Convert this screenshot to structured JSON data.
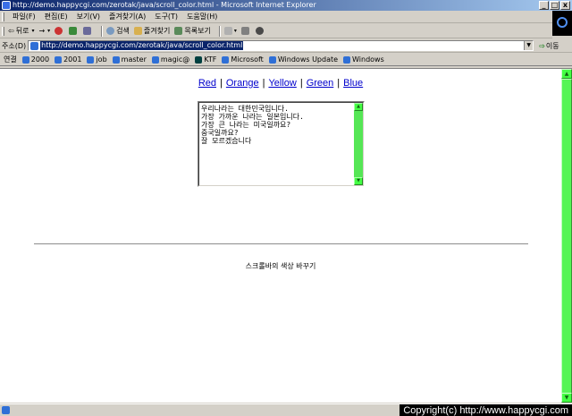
{
  "window": {
    "title": "http://demo.happycgi.com/zerotak/java/scroll_color.html - Microsoft Internet Explorer",
    "min_glyph": "_",
    "max_glyph": "□",
    "close_glyph": "x"
  },
  "menubar": {
    "items": [
      "파일(F)",
      "편집(E)",
      "보기(V)",
      "즐겨찾기(A)",
      "도구(T)",
      "도움말(H)"
    ]
  },
  "toolbar": {
    "back": "뒤로",
    "forward": "→",
    "search": "검색",
    "favorites": "즐겨찾기",
    "history": "목록보기"
  },
  "address": {
    "label": "주소(D)",
    "url": "http://demo.happycgi.com/zerotak/java/scroll_color.html",
    "go": "이동"
  },
  "links": {
    "label": "연결",
    "items": [
      "2000",
      "2001",
      "job",
      "master",
      "magic@",
      "KTF",
      "Microsoft",
      "Windows Update",
      "Windows"
    ]
  },
  "page": {
    "color_links": [
      "Red",
      "Orange",
      "Yellow",
      "Green",
      "Blue"
    ],
    "separator": "|",
    "textarea_text": "우리나라는 대한민국입니다.\n가장 가까운 나라는 일본입니다.\n가장 큰 나라는 미국일까요?\n중국일까요?\n잘 모르겠습니다",
    "caption": "스크롤바의 색상 바꾸기"
  },
  "statusbar": {
    "copyright": "Copyright(c) http://www.happycgi.com"
  },
  "colors": {
    "scrollbar_face": "#55e655",
    "link": "#0000cc",
    "title_bar": "#0a246a"
  }
}
